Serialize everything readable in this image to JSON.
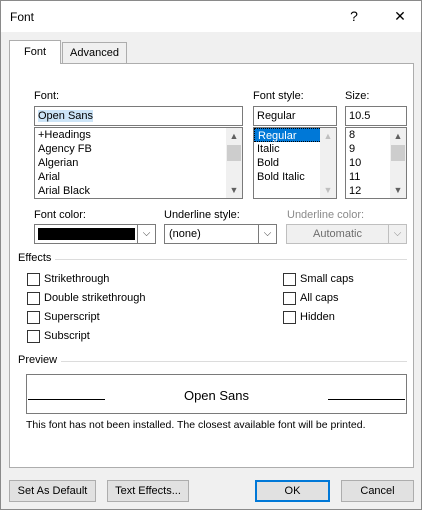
{
  "window": {
    "title": "Font",
    "help_label": "?",
    "close_label": "✕"
  },
  "tabs": [
    {
      "label": "Font",
      "accel": "n"
    },
    {
      "label": "Advanced",
      "accel": "v"
    }
  ],
  "font": {
    "label": "Font:",
    "value": "Open Sans",
    "options": [
      "+Headings",
      "Agency FB",
      "Algerian",
      "Arial",
      "Arial Black"
    ]
  },
  "style": {
    "label": "Font style:",
    "value": "Regular",
    "options": [
      "Regular",
      "Italic",
      "Bold",
      "Bold Italic"
    ],
    "selected": "Regular"
  },
  "size": {
    "label": "Size:",
    "value": "10.5",
    "options": [
      "8",
      "9",
      "10",
      "11",
      "12"
    ]
  },
  "font_color": {
    "label": "Font color:",
    "swatch": "#000000"
  },
  "underline_style": {
    "label": "Underline style:",
    "value": "(none)"
  },
  "underline_color": {
    "label": "Underline color:",
    "value": "Automatic"
  },
  "effects": {
    "title": "Effects",
    "left": [
      "Strikethrough",
      "Double strikethrough",
      "Superscript",
      "Subscript"
    ],
    "right": [
      "Small caps",
      "All caps",
      "Hidden"
    ]
  },
  "preview": {
    "title": "Preview",
    "sample": "Open Sans",
    "note": "This font has not been installed. The closest available font will be printed."
  },
  "buttons": {
    "set_default": "Set As Default",
    "text_effects": "Text Effects...",
    "ok": "OK",
    "cancel": "Cancel"
  },
  "colors": {
    "accent": "#0078d7",
    "selection_bg": "#cce4f7"
  }
}
